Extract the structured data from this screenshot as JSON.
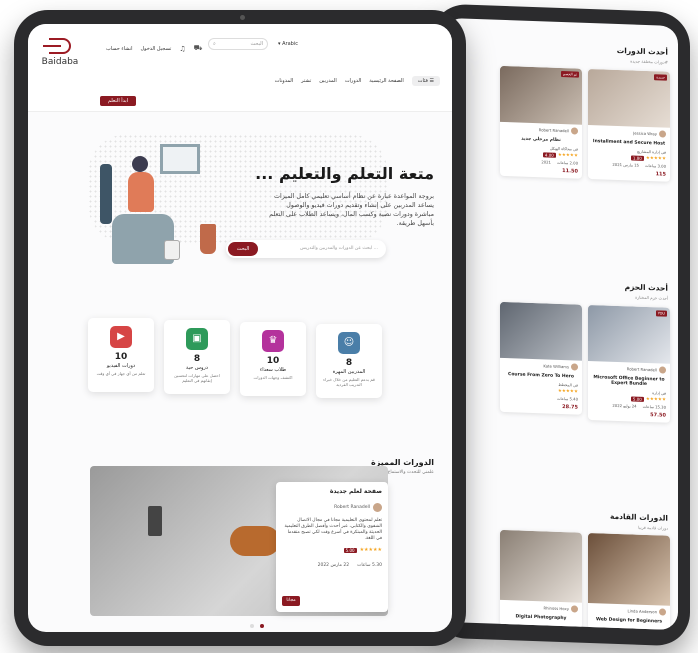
{
  "brand": {
    "name": "Baidaba",
    "accent": "#8b1a22"
  },
  "header": {
    "links": [
      "انشاء حساب",
      "تسجيل الدخول"
    ],
    "search_placeholder": "البحث",
    "lang": "Arabic",
    "nav": [
      "الصفحة الرئيسية",
      "الدورات",
      "المدربين",
      "تشتر",
      "المدونات"
    ],
    "cats_label": "فئات",
    "start_label": "ابدأ التعلم"
  },
  "hero": {
    "title": "متعة التعلم والتعليم ...",
    "description": "بروجة المواعدة عبارة عن نظام أساسي تعليمي كامل الميزات يساعد المدربين على إنشاء وتقديم دورات فيديو والوصول مباشرة ودورات نصية وكسب المال، ويساعد الطلاب على التعلم بأسهل طريقة.",
    "search_placeholder": "ابحث عن الدورات والمدربين والتدريس ...",
    "search_button": "البحث"
  },
  "stats": [
    {
      "num": "8",
      "label": "المدربين المهرة",
      "sub": "قم بدعم التعليم من خلال خبراء التدريب الفردية",
      "color": "#4a7ea8"
    },
    {
      "num": "10",
      "label": "طلاب سعداء",
      "sub": "اكتشف وجهات الدورات",
      "color": "#b4329c"
    },
    {
      "num": "8",
      "label": "دروس حية",
      "sub": "احصل على مهارات لتحسين إتقانهم في التعليم",
      "color": "#2e9a5a"
    },
    {
      "num": "10",
      "label": "دورات الفيديو",
      "sub": "تعلم من أي جهاز في أي وقت",
      "color": "#d64545"
    }
  ],
  "featured": {
    "title": "الدورات المميزة",
    "subtitle": "علمني للتحدث والاستماع إلى الآخرين",
    "card": {
      "title": "صفحة لعلم جديدة",
      "instructor": "Robert Ranadell",
      "desc": "تعلم لمحتوى التعليمية مجانا في مجال الاتصال الشفوي والكتابي، عبر أحدث وأفضل الطرق التعليمية الحديثة والمبتكرة في أسرع وقت لكي تصبح متقدما في اللغة.",
      "rating": "5.00",
      "stars": "★★★★★",
      "hours": "5.30 ساعات",
      "date": "22 مارس 2022",
      "button": "مجانا"
    }
  },
  "back": {
    "latest_title": "أحدث الدورات",
    "latest_sub": "#دورات مختلفة جديدة",
    "bundles_title": "أحدث الحزم",
    "bundles_sub": "أحدث حزم المختارة",
    "upcoming_title": "الدورات القادمة",
    "upcoming_sub": "دورات قادمة قريبا",
    "courses": [
      {
        "tag": "جديدة",
        "instructor": "Jessica Wray",
        "title": "Installment and Secure Host",
        "category": "في إدارة المشاريع",
        "rating": "1.80",
        "hours": "3.00 ساعات",
        "date": "15 مارس 2021",
        "price": "115"
      },
      {
        "tag": "تم الخصم",
        "instructor": "Robert Ranadell",
        "title": "نظام مرحلي جديد",
        "category": "في محاكاة الهيكل",
        "rating": "4.00",
        "hours": "2.00 ساعات",
        "date": "2021",
        "price": "11.50"
      }
    ],
    "bundles": [
      {
        "tag": "YOU",
        "instructor": "Robert Ranadell",
        "title": "Microsoft Office Beginner to Expert Bundle",
        "category": "في إدارة",
        "rating": "5.00",
        "hours": "15.30 ساعات",
        "date": "24 يوليو 2022",
        "price": "57.50"
      },
      {
        "tag": "",
        "instructor": "Kate Williams",
        "title": "Course From Zero To Hero",
        "category": "في المخطط",
        "rating": "4.00",
        "hours": "5.40 ساعات",
        "date": "",
        "price": "28.75"
      }
    ],
    "upcoming": [
      {
        "instructor": "Linda Anderson",
        "title": "Web Design for Beginners"
      },
      {
        "instructor": "Rhinoss Hoxy",
        "title": "Digital Photography"
      }
    ]
  }
}
